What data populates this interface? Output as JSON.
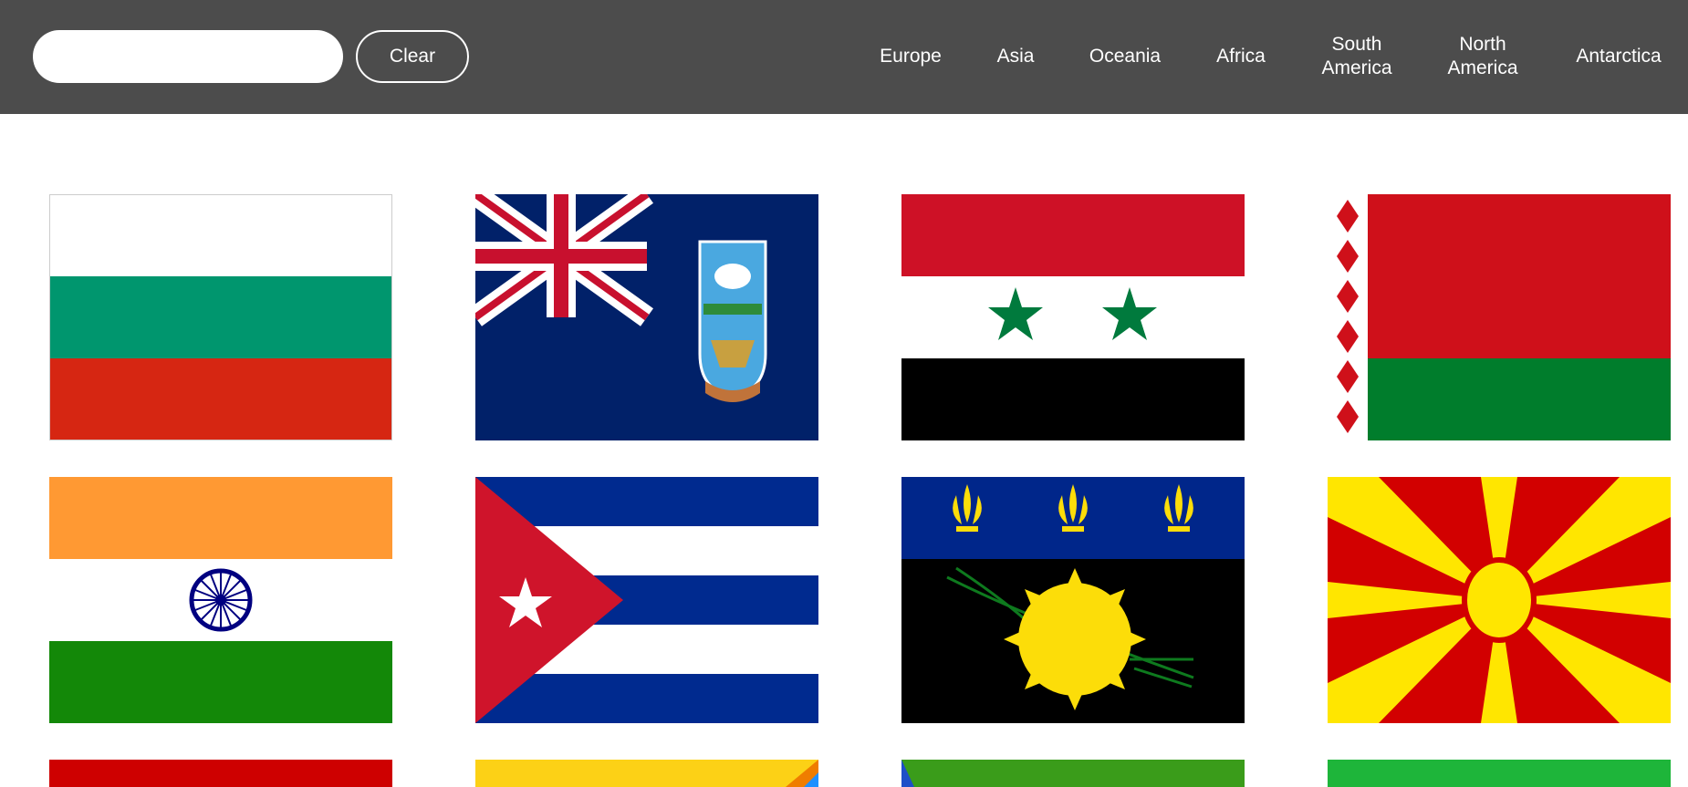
{
  "search": {
    "value": "",
    "placeholder": ""
  },
  "clear_label": "Clear",
  "regions": [
    "Europe",
    "Asia",
    "Oceania",
    "Africa",
    "South\nAmerica",
    "North\nAmerica",
    "Antarctica"
  ],
  "flags": [
    {
      "icon": "bulgaria-flag-icon",
      "colors": [
        "#ffffff",
        "#00966e",
        "#d62612"
      ]
    },
    {
      "icon": "falkland-islands-flag-icon",
      "colors": [
        "#012169",
        "#ffffff",
        "#c8102e"
      ]
    },
    {
      "icon": "syria-flag-icon",
      "colors": [
        "#ce1126",
        "#ffffff",
        "#000000",
        "#007a3d"
      ]
    },
    {
      "icon": "belarus-flag-icon",
      "colors": [
        "#cf101a",
        "#007d2c",
        "#ffffff"
      ]
    },
    {
      "icon": "india-flag-icon",
      "colors": [
        "#ff9933",
        "#ffffff",
        "#138808",
        "#000080"
      ]
    },
    {
      "icon": "cuba-flag-icon",
      "colors": [
        "#002a8f",
        "#ffffff",
        "#cf142b"
      ]
    },
    {
      "icon": "guadeloupe-flag-icon",
      "colors": [
        "#00268a",
        "#000000",
        "#fcdd09",
        "#006600"
      ]
    },
    {
      "icon": "north-macedonia-flag-icon",
      "colors": [
        "#d20000",
        "#ffe600"
      ]
    },
    {
      "icon": "partial-flag-red-icon",
      "colors": [
        "#ce0000"
      ]
    },
    {
      "icon": "partial-flag-yellow-icon",
      "colors": [
        "#fcd116",
        "#ef7d00",
        "#1e90ff"
      ]
    },
    {
      "icon": "partial-flag-green-icon",
      "colors": [
        "#3a9c1a",
        "#1e4fc8"
      ]
    },
    {
      "icon": "partial-flag-lightgreen-icon",
      "colors": [
        "#1eb53a"
      ]
    }
  ]
}
